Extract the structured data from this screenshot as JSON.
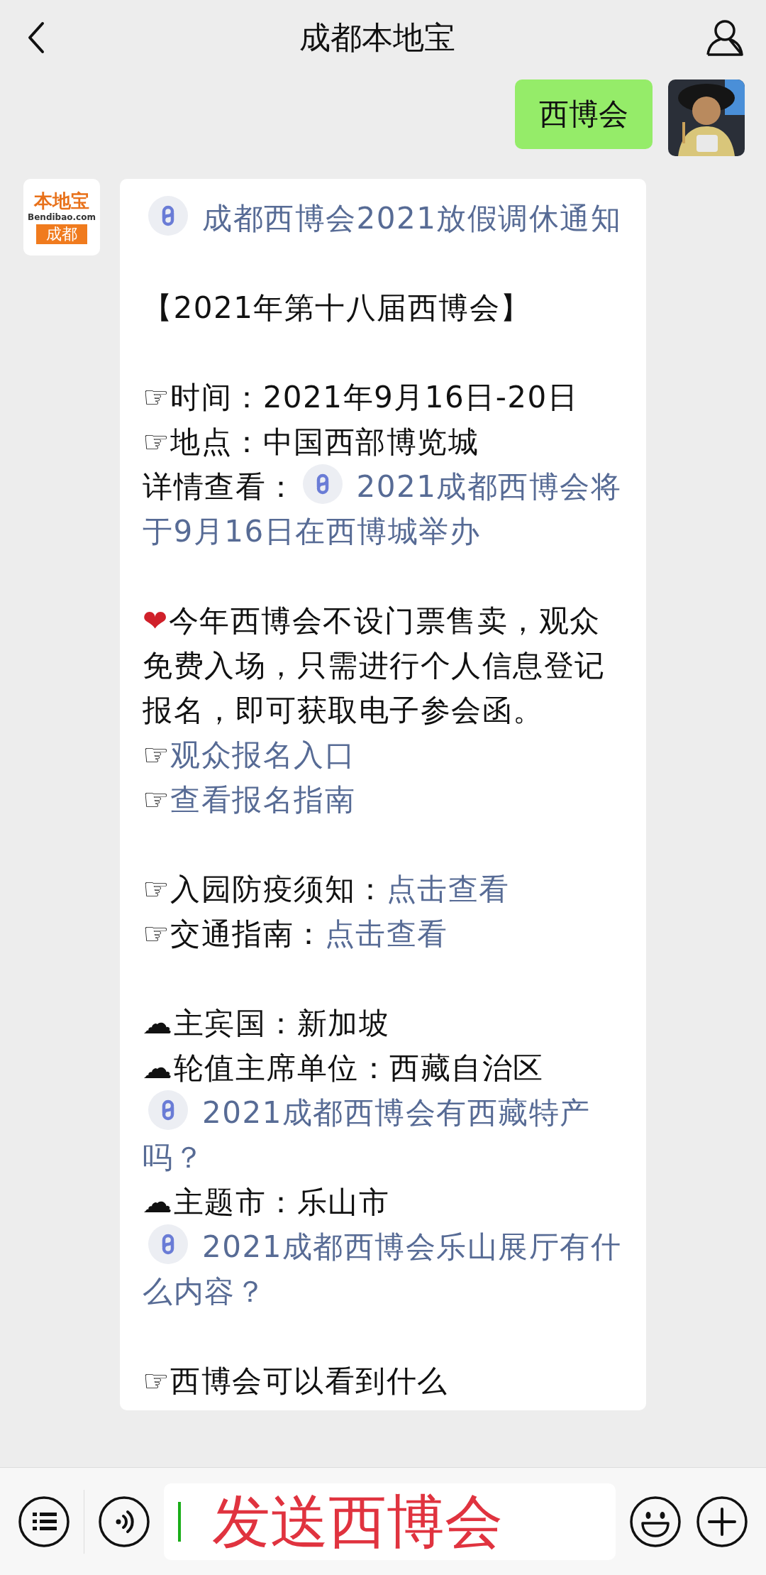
{
  "header": {
    "title": "成都本地宝"
  },
  "messages": [
    {
      "kind": "text",
      "text": "西博会"
    },
    {
      "kind": "rich",
      "logo": [
        "本地宝",
        "Bendibao.com",
        "成都"
      ],
      "paragraphs": [
        [
          [
            {
              "kind": "mini",
              "text": "成都西博会2021放假调休通知"
            }
          ]
        ],
        [
          [
            {
              "kind": "text",
              "text": "【2021年第十八届西博会】"
            }
          ]
        ],
        [
          [
            {
              "kind": "text",
              "text": "☞时间：2021年9月16日-20日"
            }
          ],
          [
            {
              "kind": "text",
              "text": "☞地点：中国西部博览城"
            }
          ],
          [
            {
              "kind": "text",
              "text": "详情查看："
            },
            {
              "kind": "mini",
              "text": "2021成都西博会将于9月16日在西博城举办"
            }
          ]
        ],
        [
          [
            {
              "kind": "heart",
              "text": "❤"
            },
            {
              "kind": "text",
              "text": "今年西博会不设门票售卖，观众免费入场，只需进行个人信息登记报名，即可获取电子参会函。"
            }
          ],
          [
            {
              "kind": "text",
              "text": "☞"
            },
            {
              "kind": "link",
              "text": "观众报名入口"
            }
          ],
          [
            {
              "kind": "text",
              "text": "☞"
            },
            {
              "kind": "link",
              "text": "查看报名指南"
            }
          ]
        ],
        [
          [
            {
              "kind": "text",
              "text": "☞入园防疫须知："
            },
            {
              "kind": "link",
              "text": "点击查看"
            }
          ],
          [
            {
              "kind": "text",
              "text": "☞交通指南："
            },
            {
              "kind": "link",
              "text": "点击查看"
            }
          ]
        ],
        [
          [
            {
              "kind": "text",
              "text": "☁主宾国：新加坡"
            }
          ],
          [
            {
              "kind": "text",
              "text": "☁轮值主席单位：西藏自治区"
            }
          ],
          [
            {
              "kind": "mini",
              "text": "2021成都西博会有西藏特产吗？"
            }
          ],
          [
            {
              "kind": "text",
              "text": "☁主题市：乐山市"
            }
          ],
          [
            {
              "kind": "mini",
              "text": "2021成都西博会乐山展厅有什么内容？"
            }
          ]
        ],
        [
          [
            {
              "kind": "text",
              "text": "☞西博会可以看到什么"
            }
          ]
        ]
      ]
    }
  ],
  "input": {
    "value": "发送西博会"
  }
}
